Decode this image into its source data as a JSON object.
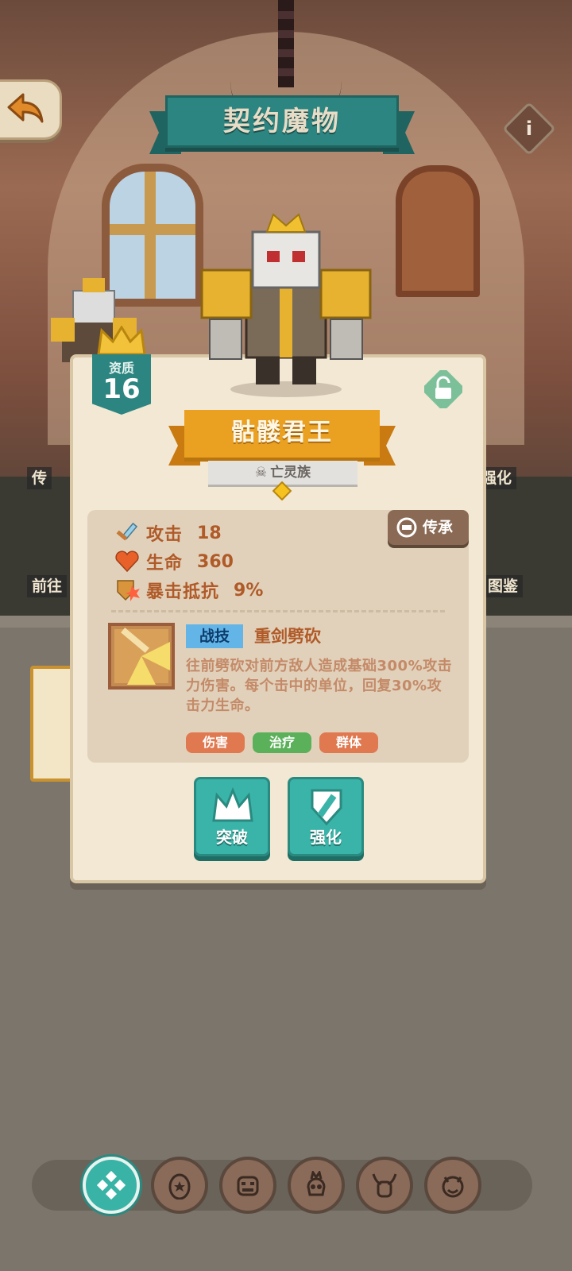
{
  "header": {
    "title": "契约魔物"
  },
  "side_labels": {
    "left_top": "传",
    "right_top": "强化",
    "left_bottom": "前往",
    "right_bottom": "图鉴"
  },
  "monster": {
    "quality_label": "资质",
    "quality_value": "16",
    "name": "骷髅君王",
    "race": "亡灵族"
  },
  "stats": [
    {
      "key": "攻击",
      "value": "18",
      "icon": "sword-icon"
    },
    {
      "key": "生命",
      "value": "360",
      "icon": "heart-icon"
    },
    {
      "key": "暴击抵抗",
      "value": "9%",
      "icon": "crit-shield-icon"
    }
  ],
  "inherit_button": "传承",
  "skill": {
    "tag": "战技",
    "name": "重剑劈砍",
    "description": "往前劈砍对前方敌人造成基础300%攻击力伤害。每个击中的单位，回复30%攻击力生命。",
    "tags": [
      {
        "label": "伤害",
        "color": "#e07850"
      },
      {
        "label": "治疗",
        "color": "#5bb05a"
      },
      {
        "label": "群体",
        "color": "#e07850"
      }
    ]
  },
  "actions": {
    "breakthrough": "突破",
    "enhance": "强化"
  },
  "tabs": [
    "home",
    "egg",
    "beast",
    "skull-fire",
    "horned",
    "demon"
  ],
  "colors": {
    "teal": "#2c8580",
    "gold": "#eaa020",
    "panel": "#f2e8d4"
  }
}
